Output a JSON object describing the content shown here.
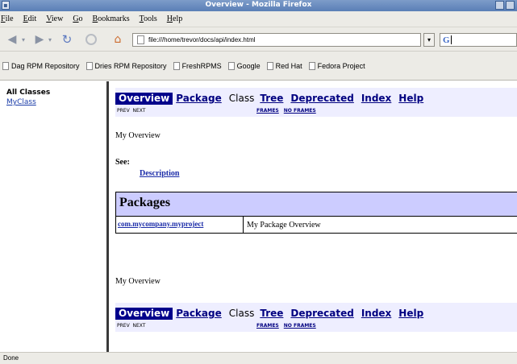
{
  "window": {
    "title": "Overview - Mozilla Firefox"
  },
  "menu": [
    "File",
    "Edit",
    "View",
    "Go",
    "Bookmarks",
    "Tools",
    "Help"
  ],
  "url": "file:///home/trevor/docs/api/index.html",
  "search": {
    "engine_glyph": "G"
  },
  "bookmarks": [
    "Dag RPM Repository",
    "Dries RPM Repository",
    "FreshRPMS",
    "Google",
    "Red Hat",
    "Fedora Project"
  ],
  "left_frame": {
    "heading": "All Classes",
    "classes": [
      "MyClass"
    ]
  },
  "nav": {
    "overview": "Overview",
    "package": "Package",
    "class": "Class",
    "tree": "Tree",
    "deprecated": "Deprecated",
    "index": "Index",
    "help": "Help",
    "prev": "PREV",
    "next": "NEXT",
    "frames": "FRAMES",
    "no_frames": "NO FRAMES"
  },
  "main": {
    "overview_text": "My Overview",
    "see_label": "See:",
    "see_link": "Description",
    "packages_heading": "Packages",
    "packages": [
      {
        "name": "com.mycompany.myproject",
        "description": "My Package Overview"
      }
    ],
    "footer_overview_text": "My Overview"
  },
  "status": "Done",
  "colors": {
    "nav_bg": "#eeeeff",
    "nav_current": "#00008b",
    "table_head": "#ccccff",
    "titlebar": "#6a8cc0"
  },
  "icons": [
    "back-arrow-icon",
    "forward-arrow-icon",
    "reload-icon",
    "stop-icon",
    "home-icon",
    "page-icon",
    "google-icon",
    "bookmark-page-icon"
  ]
}
